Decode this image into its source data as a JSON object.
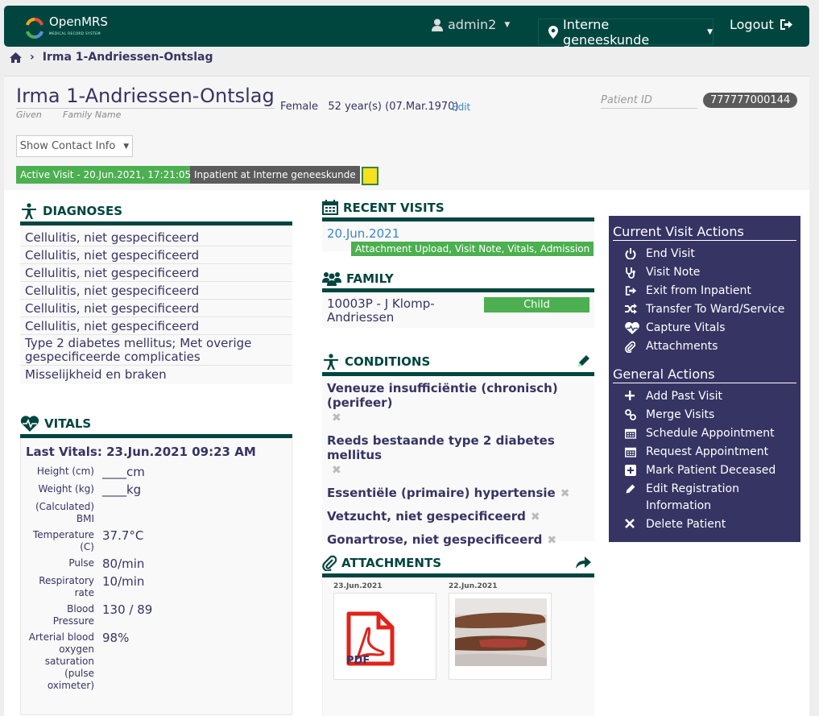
{
  "topbar": {
    "brand": "OpenMRS",
    "brand_sub": "MEDICAL RECORD SYSTEM",
    "user": "admin2",
    "location": "Interne geneeskunde",
    "logout": "Logout"
  },
  "breadcrumb": {
    "patient": "Irma 1-Andriessen-Ontslag"
  },
  "patient": {
    "name": "Irma 1-Andriessen-Ontslag",
    "given_label": "Given",
    "family_label": "Family Name",
    "info": "Female   52 year(s) (07.Mar.1970)",
    "edit": "Edit",
    "id_label": "Patient ID",
    "id_value": "777777000144",
    "contact_button": "Show Contact Info",
    "active_visit": "Active Visit - 20.Jun.2021, 17:21:05",
    "inpatient": "Inpatient at Interne geneeskunde"
  },
  "diagnoses": {
    "title": "DIAGNOSES",
    "items": [
      "Cellulitis, niet gespecificeerd",
      "Cellulitis, niet gespecificeerd",
      "Cellulitis, niet gespecificeerd",
      "Cellulitis, niet gespecificeerd",
      "Cellulitis, niet gespecificeerd",
      "Cellulitis, niet gespecificeerd",
      "Type 2 diabetes mellitus; Met overige gespecificeerde complicaties",
      "Misselijkheid en braken"
    ]
  },
  "vitals": {
    "title": "VITALS",
    "last": "Last Vitals: 23.Jun.2021 09:23 AM",
    "rows": [
      {
        "label": "Height (cm)",
        "value": "____cm"
      },
      {
        "label": "Weight (kg)",
        "value": "____kg"
      },
      {
        "label": "(Calculated) BMI",
        "value": ""
      },
      {
        "label": "Temperature (C)",
        "value": "37.7°C"
      },
      {
        "label": "Pulse",
        "value": "80/min"
      },
      {
        "label": "Respiratory rate",
        "value": "10/min"
      },
      {
        "label": "Blood Pressure",
        "value": "130 / 89"
      },
      {
        "label": "Arterial blood oxygen saturation (pulse oximeter)",
        "value": "98%"
      }
    ]
  },
  "recent_visits": {
    "title": "RECENT VISITS",
    "date": "20.Jun.2021",
    "tag": "Attachment Upload, Visit Note, Vitals, Admission"
  },
  "family": {
    "title": "FAMILY",
    "member": "10003P - J Klomp-Andriessen",
    "relation": "Child"
  },
  "conditions": {
    "title": "CONDITIONS",
    "items": [
      "Veneuze insufficiëntie (chronisch) (perifeer)",
      "Reeds bestaande type 2 diabetes mellitus",
      "Essentiële (primaire) hypertensie",
      "Vetzucht, niet gespecificeerd",
      "Gonartrose, niet gespecificeerd"
    ]
  },
  "attachments": {
    "title": "ATTACHMENTS",
    "items": [
      {
        "date": "23.Jun.2021",
        "type": "pdf",
        "pdf_label": "PDF"
      },
      {
        "date": "22.Jun.2021",
        "type": "image"
      }
    ]
  },
  "actions": {
    "current_title": "Current Visit Actions",
    "current": [
      {
        "label": "End Visit",
        "icon": "power-icon"
      },
      {
        "label": "Visit Note",
        "icon": "stethoscope-icon"
      },
      {
        "label": "Exit from Inpatient",
        "icon": "exit-icon"
      },
      {
        "label": "Transfer To Ward/Service",
        "icon": "shuffle-icon"
      },
      {
        "label": "Capture Vitals",
        "icon": "heart-icon"
      },
      {
        "label": "Attachments",
        "icon": "paperclip-icon"
      }
    ],
    "general_title": "General Actions",
    "general": [
      {
        "label": "Add Past Visit",
        "icon": "plus-icon"
      },
      {
        "label": "Merge Visits",
        "icon": "link-icon"
      },
      {
        "label": "Schedule Appointment",
        "icon": "calendar-icon"
      },
      {
        "label": "Request Appointment",
        "icon": "calendar-icon"
      },
      {
        "label": "Mark Patient Deceased",
        "icon": "plus-square-icon"
      },
      {
        "label": "Edit Registration Information",
        "icon": "pencil-icon"
      },
      {
        "label": "Delete Patient",
        "icon": "x-icon"
      }
    ]
  }
}
